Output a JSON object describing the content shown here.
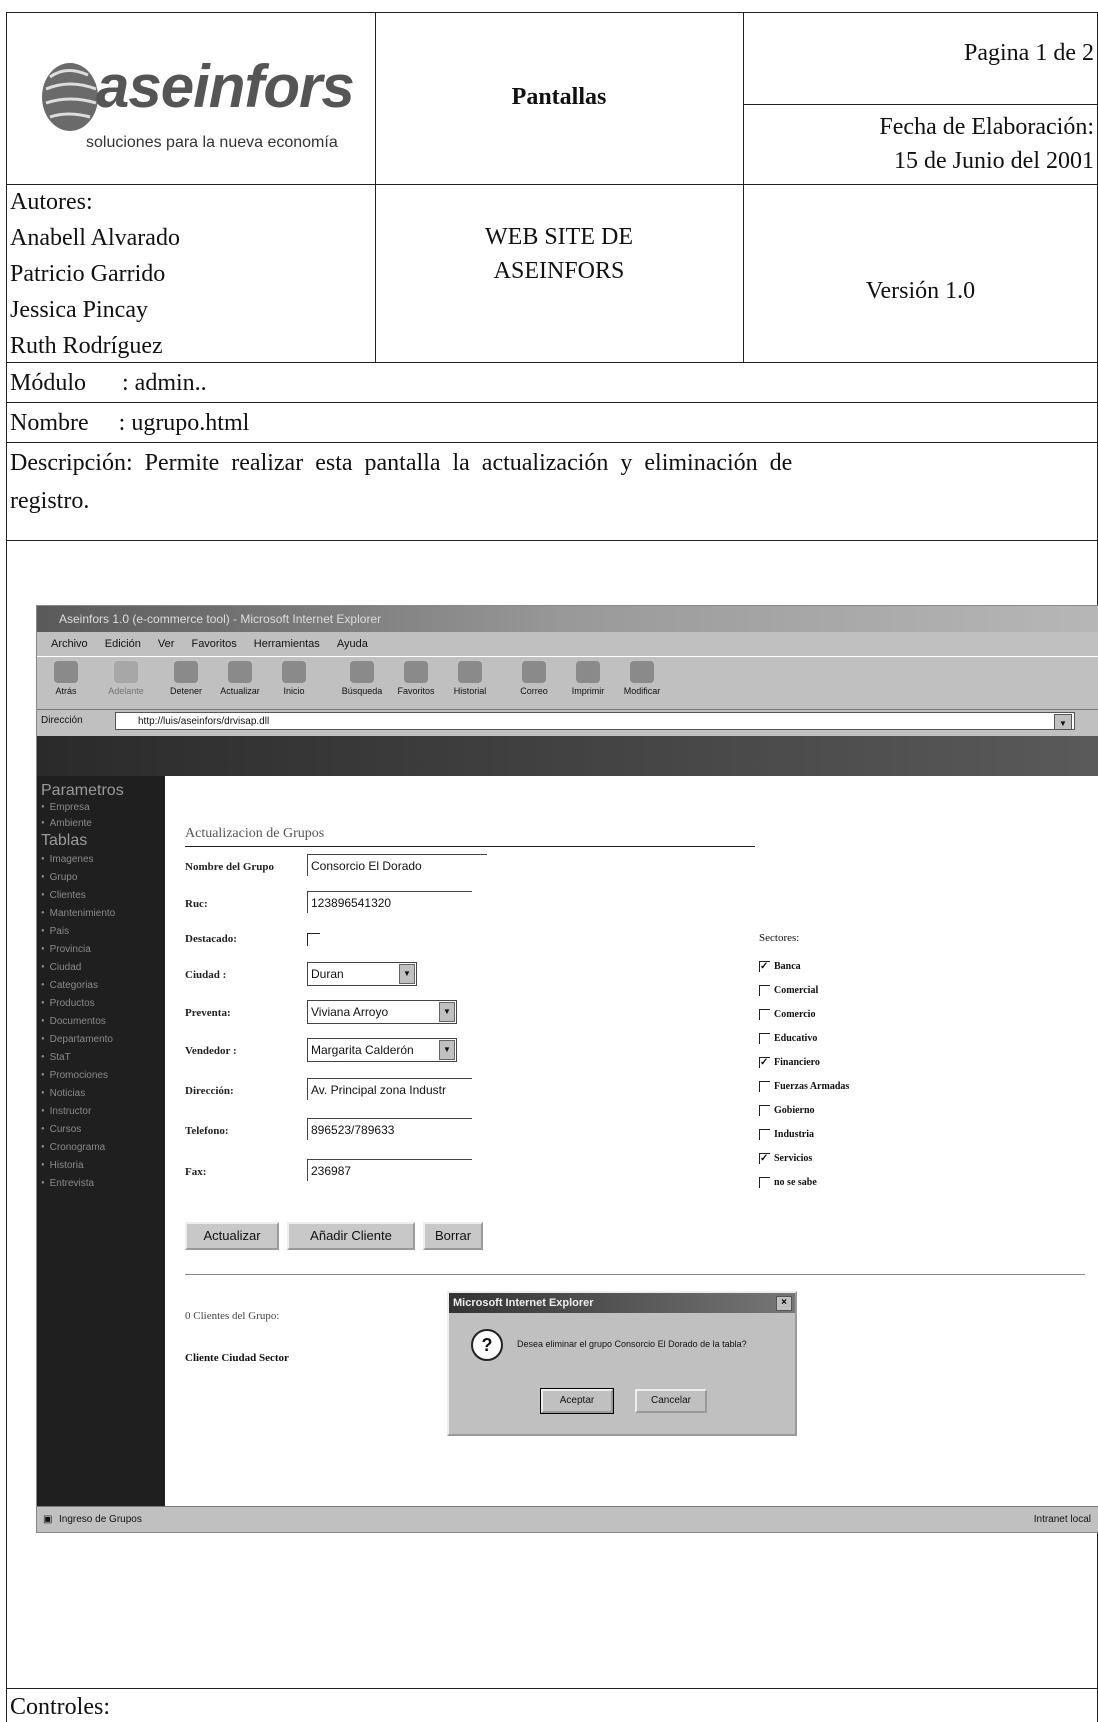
{
  "header": {
    "logo_text": "aseinfors",
    "logo_tagline": "soluciones para la nueva economía",
    "doc_type": "Pantallas",
    "page_label": "Pagina 1 de 2",
    "fecha_label": "Fecha de Elaboración:",
    "fecha_value": "15 de Junio del 2001"
  },
  "authors": {
    "label": "Autores:",
    "names": [
      "Anabell Alvarado",
      "Patricio Garrido",
      "Jessica Pincay",
      "Ruth Rodríguez"
    ]
  },
  "project": {
    "line1": "WEB SITE DE",
    "line2": "ASEINFORS"
  },
  "version": "Versión 1.0",
  "modulo": "Módulo      : admin..",
  "nombre": "Nombre     : ugrupo.html",
  "descripcion": {
    "line1": "Descripción:  Permite  realizar  esta  pantalla  la  actualización  y  eliminación  de",
    "line2": "registro."
  },
  "controles": "Controles:",
  "browser": {
    "title": "Aseinfors 1.0 (e-commerce tool) - Microsoft Internet Explorer",
    "menu": [
      "Archivo",
      "Edición",
      "Ver",
      "Favoritos",
      "Herramientas",
      "Ayuda"
    ],
    "toolbar": [
      "Atrás",
      "Adelante",
      "Detener",
      "Actualizar",
      "Inicio",
      "Búsqueda",
      "Favoritos",
      "Historial",
      "Correo",
      "Imprimir",
      "Modificar"
    ],
    "address_label": "Dirección",
    "address_value": "http://luis/aseinfors/drvisap.dll",
    "status_left": "Ingreso de Grupos",
    "status_right": "Intranet local"
  },
  "sidebar": {
    "heading1": "Parametros",
    "group1": [
      "Empresa",
      "Ambiente"
    ],
    "heading2": "Tablas",
    "group2": [
      "Imagenes",
      "Grupo",
      "Clientes",
      "Mantenimiento",
      "Pais",
      "Provincia",
      "Ciudad",
      "Categorias",
      "Productos",
      "Documentos",
      "Departamento",
      "StaT",
      "Promociones",
      "Noticias",
      "Instructor",
      "Cursos",
      "Cronograma",
      "Historia",
      "Entrevista"
    ]
  },
  "form": {
    "title": "Actualizacion de Grupos",
    "fields": [
      {
        "label": "Nombre del Grupo",
        "value": "Consorcio El Dorado"
      },
      {
        "label": "Ruc:",
        "value": "123896541320"
      },
      {
        "label": "Destacado:"
      },
      {
        "label": "Ciudad :",
        "value": "Duran"
      },
      {
        "label": "Preventa:",
        "value": "Viviana Arroyo"
      },
      {
        "label": "Vendedor :",
        "value": "Margarita Calderón"
      },
      {
        "label": "Dirección:",
        "value": "Av. Principal zona Industr"
      },
      {
        "label": "Telefono:",
        "value": "896523/789633"
      },
      {
        "label": "Fax:",
        "value": "236987"
      }
    ],
    "sectores_label": "Sectores:",
    "sectores": [
      {
        "name": "Banca",
        "checked": true
      },
      {
        "name": "Comercial",
        "checked": false
      },
      {
        "name": "Comercio",
        "checked": false
      },
      {
        "name": "Educativo",
        "checked": false
      },
      {
        "name": "Financiero",
        "checked": true
      },
      {
        "name": "Fuerzas Armadas",
        "checked": false
      },
      {
        "name": "Gobierno",
        "checked": false
      },
      {
        "name": "Industria",
        "checked": false
      },
      {
        "name": "Servicios",
        "checked": true
      },
      {
        "name": "no se sabe",
        "checked": false
      }
    ],
    "buttons": [
      "Actualizar",
      "Añadir Cliente",
      "Borrar"
    ],
    "clients_count": "0 Clientes del Grupo:",
    "clients_header": "Cliente Ciudad Sector"
  },
  "dialog": {
    "title": "Microsoft Internet Explorer",
    "message": "Desea eliminar el grupo Consorcio El Dorado de la tabla?",
    "accept": "Aceptar",
    "cancel": "Cancelar"
  }
}
